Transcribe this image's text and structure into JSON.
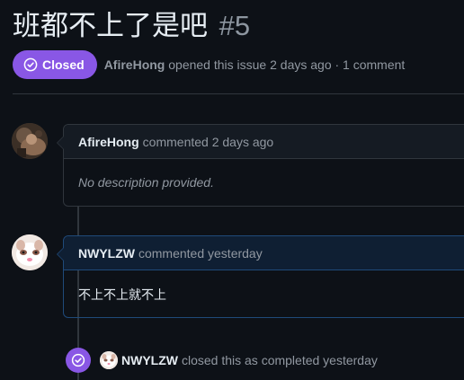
{
  "issue": {
    "title": "班都不上了是吧",
    "number": "#5",
    "state": "Closed",
    "author": "AfireHong",
    "meta": "opened this issue 2 days ago · 1 comment"
  },
  "comments": [
    {
      "author": "AfireHong",
      "action": "commented 2 days ago",
      "body": "No description provided."
    },
    {
      "author": "NWYLZW",
      "action": "commented yesterday",
      "body": "不上不上就不上"
    }
  ],
  "event": {
    "author": "NWYLZW",
    "text": "closed this as completed yesterday"
  },
  "colors": {
    "closed_purple": "#8957e5",
    "background": "#0d1117",
    "border": "#30363d",
    "highlight_border": "#1f4a7a"
  }
}
